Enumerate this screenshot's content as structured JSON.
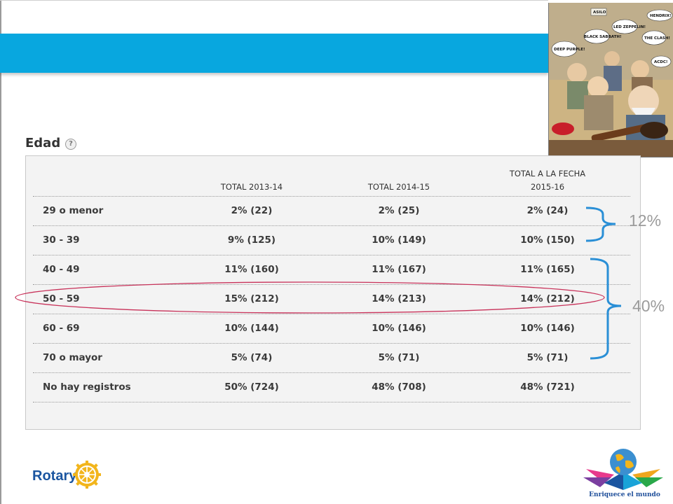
{
  "section": {
    "title": "Edad",
    "help_glyph": "?"
  },
  "table": {
    "headers": {
      "col1": "TOTAL 2013-14",
      "col2": "TOTAL 2014-15",
      "col3_line1": "TOTAL A LA FECHA",
      "col3_line2": "2015-16"
    },
    "rows": [
      {
        "label": "29 o menor",
        "v1": "2% (22)",
        "v2": "2% (25)",
        "v3": "2% (24)"
      },
      {
        "label": "30 - 39",
        "v1": "9% (125)",
        "v2": "10% (149)",
        "v3": "10% (150)"
      },
      {
        "label": "40 - 49",
        "v1": "11% (160)",
        "v2": "11% (167)",
        "v3": "11% (165)"
      },
      {
        "label": "50 - 59",
        "v1": "15% (212)",
        "v2": "14% (213)",
        "v3": "14% (212)"
      },
      {
        "label": "60 - 69",
        "v1": "10% (144)",
        "v2": "10% (146)",
        "v3": "10% (146)"
      },
      {
        "label": "70 o mayor",
        "v1": "5% (74)",
        "v2": "5% (71)",
        "v3": "5% (71)"
      },
      {
        "label": "No hay registros",
        "v1": "50% (724)",
        "v2": "48% (708)",
        "v3": "48% (721)"
      }
    ]
  },
  "annotations": {
    "group_young": "12%",
    "group_mid": "40%",
    "highlighted_row": "50 - 59"
  },
  "cartoon": {
    "bubbles": [
      "ASILO",
      "HENDRIX!",
      "LED ZEPPELIN!",
      "BLACK SABBATH!",
      "DEEP PURPLE!",
      "THE CLASH!",
      "ACDC!"
    ]
  },
  "footer": {
    "rotary_label": "Rotary",
    "theme_caption": "Enriquece el mundo"
  },
  "colors": {
    "banner": "#08a7df",
    "bracket": "#2a8fd6",
    "highlight": "#c8325a",
    "rotary_blue": "#1a55a0",
    "rotary_gold": "#f2b51c"
  }
}
